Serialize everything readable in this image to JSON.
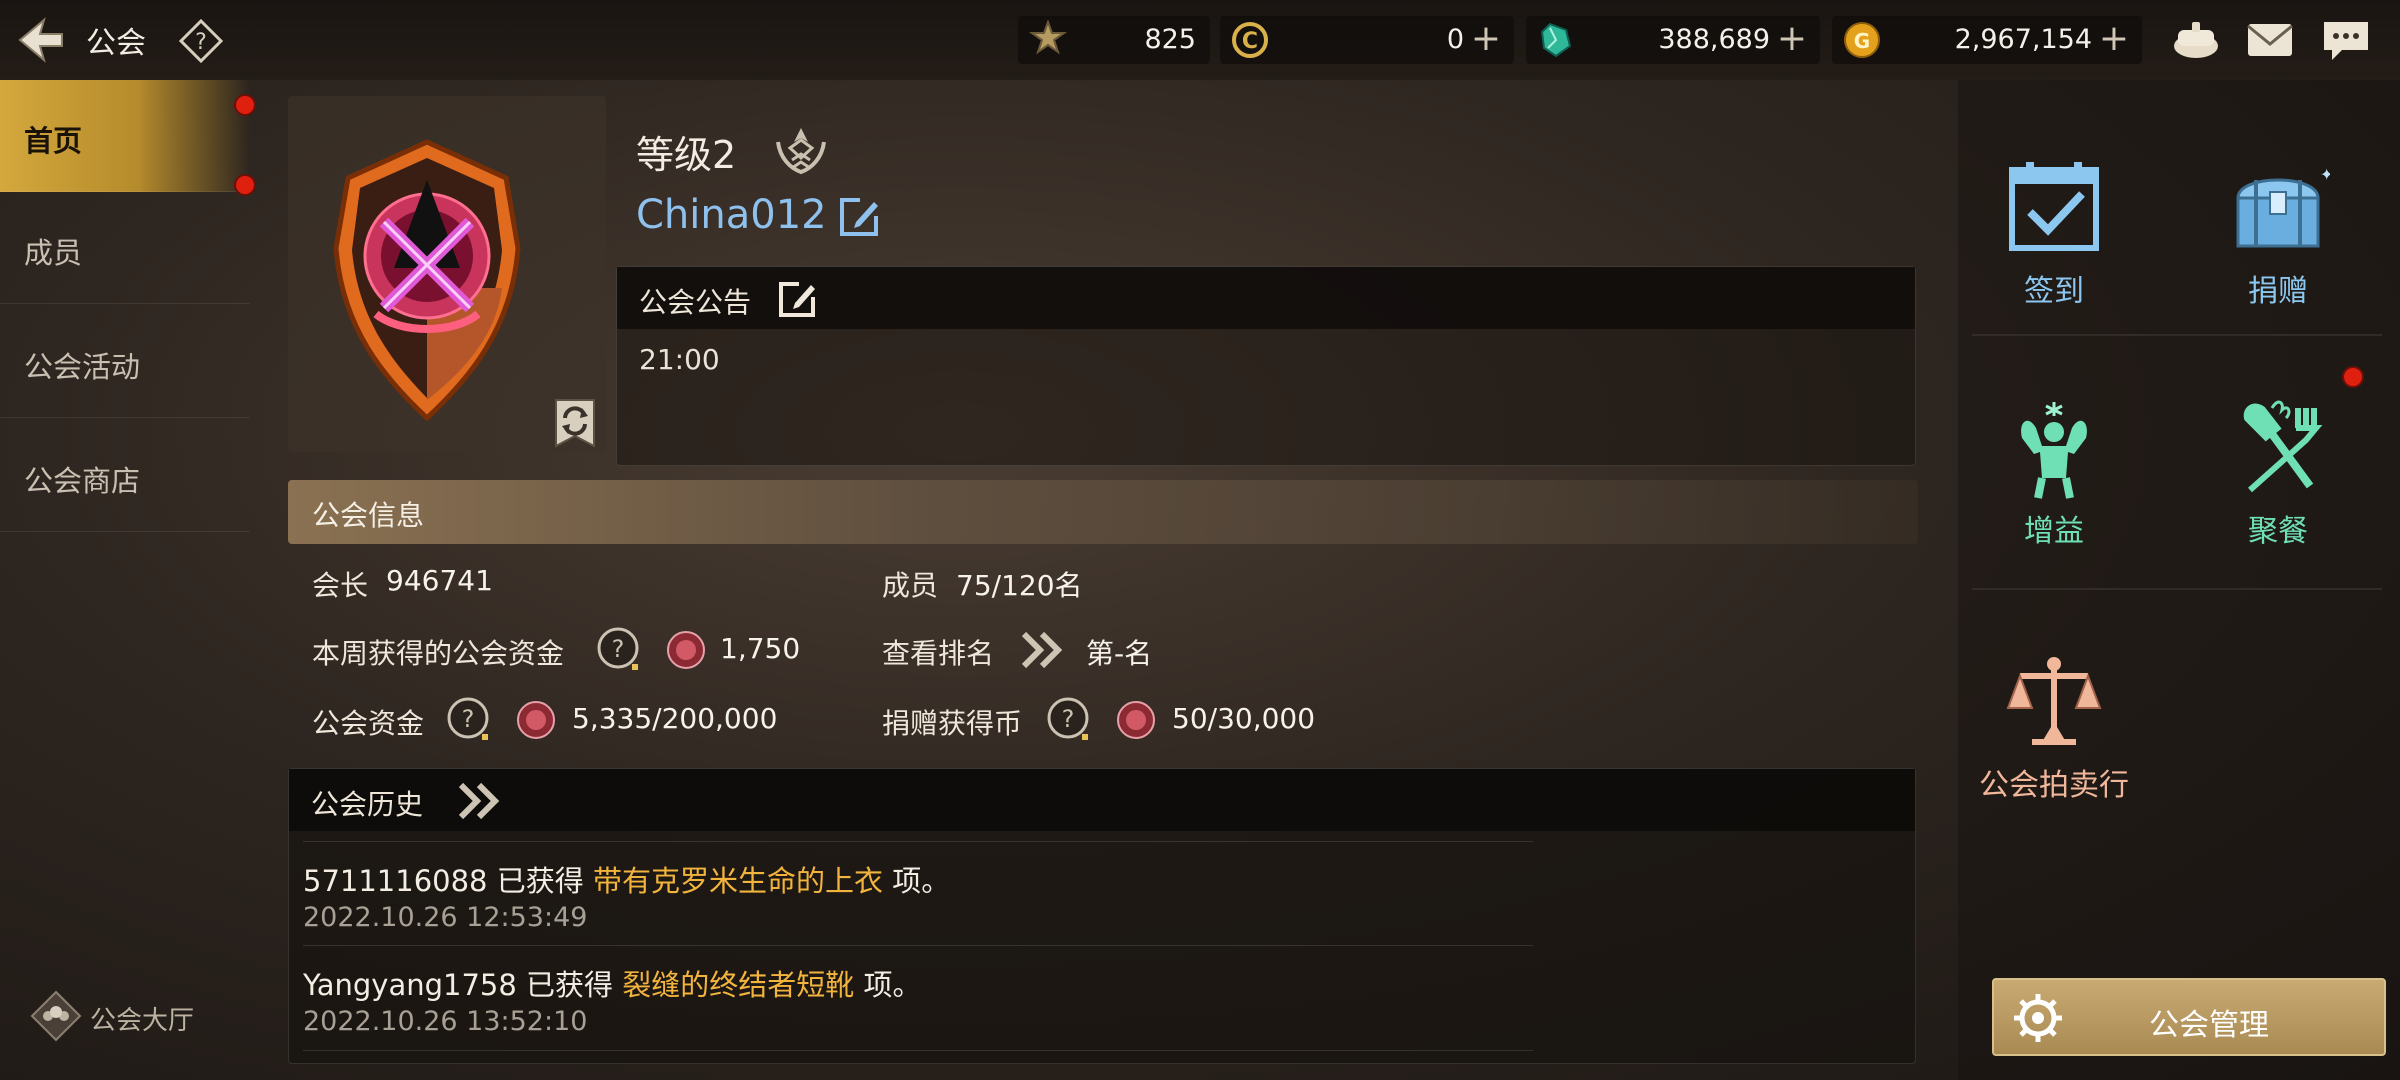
{
  "header": {
    "title": "公会"
  },
  "resources": [
    {
      "icon": "rank-medal-icon",
      "value": "825",
      "has_plus": false
    },
    {
      "icon": "c-coin-icon",
      "value": "0",
      "has_plus": true
    },
    {
      "icon": "green-crystal-icon",
      "value": "388,689",
      "has_plus": true
    },
    {
      "icon": "gold-coin-icon",
      "value": "2,967,154",
      "has_plus": true
    }
  ],
  "top_icons": [
    "chest-icon",
    "mail-icon",
    "chat-icon"
  ],
  "sidebar": {
    "items": [
      {
        "label": "首页",
        "active": true
      },
      {
        "label": "成员"
      },
      {
        "label": "公会活动"
      },
      {
        "label": "公会商店"
      }
    ],
    "hall_label": "公会大厅"
  },
  "guild": {
    "level": "等级2",
    "name": "China012"
  },
  "notice": {
    "title": "公会公告",
    "text": "21:00"
  },
  "info": {
    "title": "公会信息",
    "leader_label": "会长",
    "leader_value": "946741",
    "members_label": "成员",
    "members_value": "75/120名",
    "weekly_funds_label": "本周获得的公会资金",
    "weekly_funds_value": "1,750",
    "ranking_label": "查看排名",
    "ranking_value": "第-名",
    "funds_label": "公会资金",
    "funds_value": "5,335/200,000",
    "donation_coin_label": "捐赠获得币",
    "donation_coin_value": "50/30,000"
  },
  "history": {
    "title": "公会历史",
    "entries": [
      {
        "user": "5711116088",
        "verb": "已获得",
        "item": "带有克罗米生命的上衣",
        "suffix": "项。",
        "time": "2022.10.26 12:53:49"
      },
      {
        "user": "Yangyang1758",
        "verb": "已获得",
        "item": "裂缝的终结者短靴",
        "suffix": "项。",
        "time": "2022.10.26 13:52:10"
      }
    ]
  },
  "right_buttons": [
    {
      "label": "签到",
      "icon": "calendar-check-icon",
      "color": "#8cc7f0"
    },
    {
      "label": "捐赠",
      "icon": "treasure-chest-icon",
      "color": "#8cc7f0"
    },
    {
      "label": "增益",
      "icon": "muscle-man-icon",
      "color": "#6fe0b6"
    },
    {
      "label": "聚餐",
      "icon": "fork-knife-icon",
      "color": "#6fe0b6"
    },
    {
      "label": "公会拍卖行",
      "icon": "scales-icon",
      "color": "#f0b79a"
    }
  ],
  "manage_button": {
    "label": "公会管理"
  }
}
